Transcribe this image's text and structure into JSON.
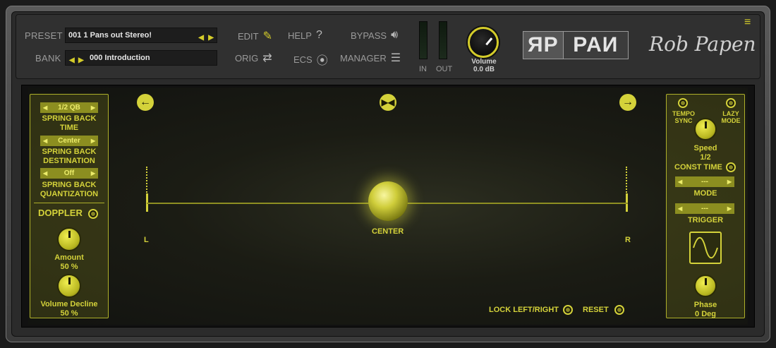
{
  "header": {
    "preset_label": "PRESET",
    "preset_value": "001 1 Pans out Stereo!",
    "bank_label": "BANK",
    "bank_value": "000 Introduction",
    "edit_label": "EDIT",
    "help_label": "HELP",
    "help_icon": "?",
    "bypass_label": "BYPASS",
    "orig_label": "ORIG",
    "ecs_label": "ECS",
    "manager_label": "MANAGER",
    "in_label": "IN",
    "out_label": "OUT",
    "volume_label": "Volume",
    "volume_value": "0.0 dB",
    "logo_rp": "ЯP",
    "logo_text": "PAИ",
    "signature": "Rob Papen",
    "accent_color": "#d4cc2a"
  },
  "left_panel": {
    "spring_back_time_value": "1/2 QB",
    "spring_back_time_label_1": "SPRING BACK",
    "spring_back_time_label_2": "TIME",
    "spring_back_dest_value": "Center",
    "spring_back_dest_label_1": "SPRING BACK",
    "spring_back_dest_label_2": "DESTINATION",
    "spring_back_quant_value": "Off",
    "spring_back_quant_label_1": "SPRING BACK",
    "spring_back_quant_label_2": "QUANTIZATION",
    "doppler_label": "DOPPLER",
    "amount_label": "Amount",
    "amount_value": "50 %",
    "volume_decline_label": "Volume Decline",
    "volume_decline_value": "50 %"
  },
  "stage": {
    "left_label": "L",
    "right_label": "R",
    "center_label": "CENTER",
    "lock_label": "LOCK LEFT/RIGHT",
    "reset_label": "RESET"
  },
  "right_panel": {
    "tempo_sync_label_1": "TEMPO",
    "tempo_sync_label_2": "SYNC",
    "lazy_mode_label_1": "LAZY",
    "lazy_mode_label_2": "MODE",
    "speed_label": "Speed",
    "speed_value": "1/2",
    "const_time_label": "CONST TIME",
    "mode_value": "---",
    "mode_label": "MODE",
    "trigger_value": "---",
    "trigger_label": "TRIGGER",
    "phase_label": "Phase",
    "phase_value": "0 Deg"
  }
}
